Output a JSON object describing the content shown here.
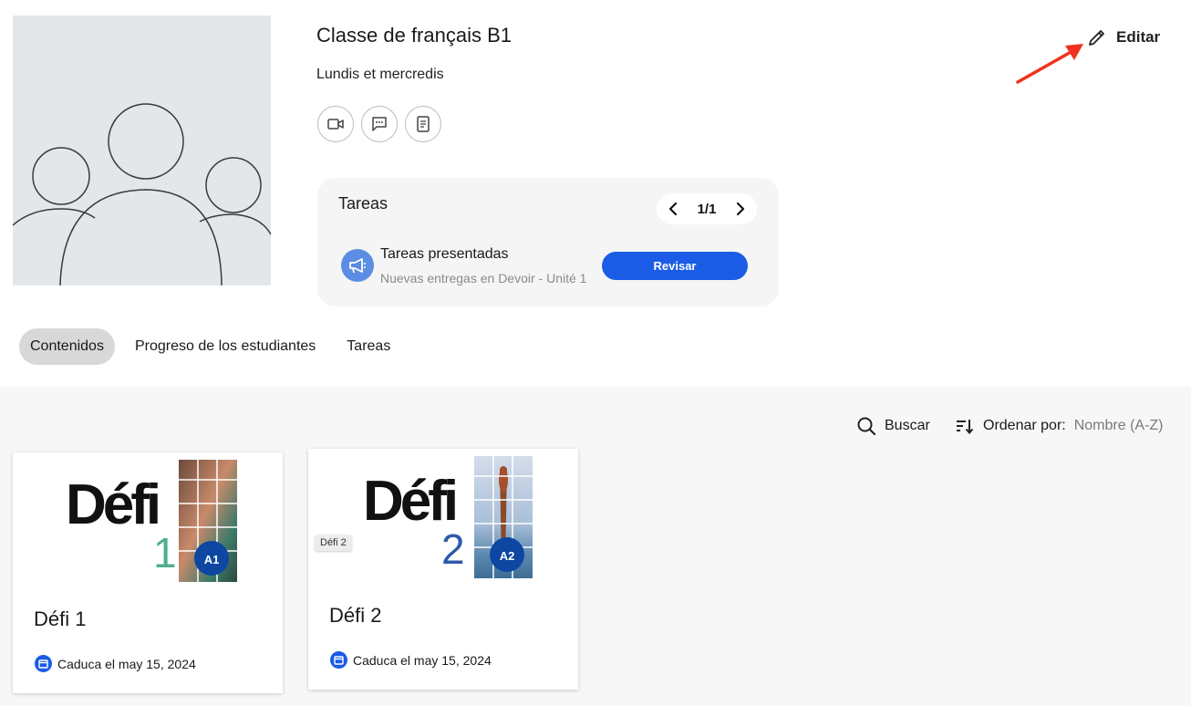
{
  "class": {
    "title": "Classe de français B1",
    "schedule": "Lundis et mercredis"
  },
  "actions": {
    "edit_label": "Editar"
  },
  "tasks_card": {
    "title": "Tareas",
    "pager": "1/1",
    "task_name": "Tareas presentadas",
    "task_desc": "Nuevas entregas en Devoir - Unité 1",
    "review_label": "Revisar"
  },
  "tabs": [
    {
      "label": "Contenidos",
      "active": true
    },
    {
      "label": "Progreso de los estudiantes",
      "active": false
    },
    {
      "label": "Tareas",
      "active": false
    }
  ],
  "toolbar": {
    "search_label": "Buscar",
    "sort_label": "Ordenar por:",
    "sort_value": "Nombre (A-Z)"
  },
  "courses": [
    {
      "title": "Défi 1",
      "cover_word": "Défi",
      "cover_number": "1",
      "level": "A1",
      "due": "Caduca el may 15, 2024"
    },
    {
      "title": "Défi 2",
      "cover_word": "Défi",
      "cover_number": "2",
      "level": "A2",
      "due": "Caduca el may 15, 2024",
      "tooltip": "Défi 2"
    }
  ],
  "colors": {
    "accent": "#1a5ce6",
    "arrow": "#f0321e",
    "defi1_number": "#4caf8f",
    "defi2_number": "#2d5aa8",
    "badge": "#0d47a1"
  },
  "icons": [
    "group-placeholder-icon",
    "video-icon",
    "chat-icon",
    "document-icon",
    "pencil-icon",
    "chevron-left-icon",
    "chevron-right-icon",
    "megaphone-icon",
    "search-icon",
    "sort-icon",
    "calendar-icon"
  ]
}
